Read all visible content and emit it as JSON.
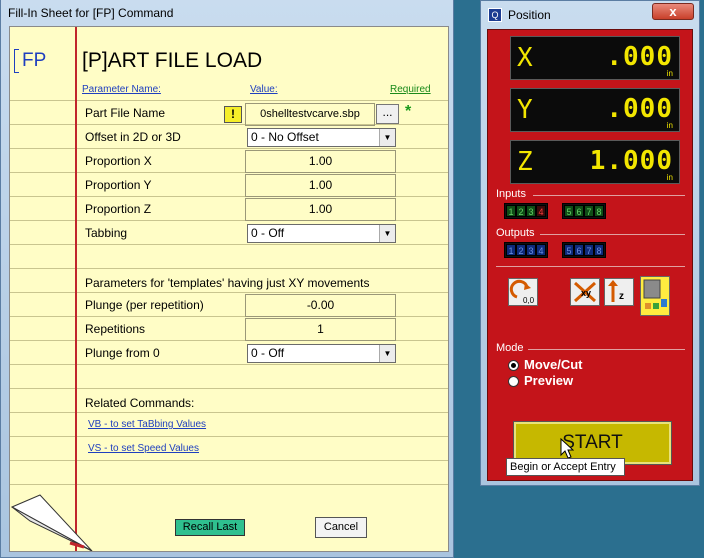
{
  "fillin_window": {
    "title": "Fill-In Sheet for [FP] Command",
    "command_code": "FP",
    "heading": "[P]ART FILE LOAD",
    "col_param": "Parameter Name:",
    "col_value": "Value:",
    "col_required": "Required",
    "params": [
      {
        "label": "Part File Name",
        "value": "0shelltestvcarve.sbp",
        "warn": "!",
        "browse": "...",
        "required_mark": "*"
      },
      {
        "label": "Offset in 2D or 3D",
        "value": "0 - No Offset"
      },
      {
        "label": "Proportion X",
        "value": "1.00"
      },
      {
        "label": "Proportion Y",
        "value": "1.00"
      },
      {
        "label": "Proportion Z",
        "value": "1.00"
      },
      {
        "label": "Tabbing",
        "value": "0 - Off"
      }
    ],
    "templates_note": "Parameters for 'templates' having just XY movements",
    "params2": [
      {
        "label": "Plunge (per repetition)",
        "value": "-0.00"
      },
      {
        "label": "Repetitions",
        "value": "1"
      },
      {
        "label": "Plunge from 0",
        "value": "0 - Off"
      }
    ],
    "related_title": "Related Commands:",
    "related_links": [
      "VB - to set TaBbing Values",
      "VS - to set Speed Values"
    ],
    "recall_label": "Recall Last",
    "cancel_label": "Cancel"
  },
  "position_window": {
    "title": "Position",
    "app_icon": "Q",
    "close_label": "x",
    "axes": [
      {
        "axis": "X",
        "value": ".000",
        "unit": "in"
      },
      {
        "axis": "Y",
        "value": ".000",
        "unit": "in"
      },
      {
        "axis": "Z",
        "value": "1.000",
        "unit": "in"
      }
    ],
    "inputs_label": "Inputs",
    "inputs": [
      "1",
      "2",
      "3",
      "4",
      "5",
      "6",
      "7",
      "8"
    ],
    "input4_active_color": "#ff3b3b",
    "outputs_label": "Outputs",
    "outputs": [
      "1",
      "2",
      "3",
      "4",
      "5",
      "6",
      "7",
      "8"
    ],
    "mode_label": "Mode",
    "mode_options": [
      "Move/Cut",
      "Preview"
    ],
    "mode_selected": "Move/Cut",
    "start_label": "START",
    "tooltip": "Begin or Accept Entry",
    "colors": {
      "panel": "#c4141a",
      "dro_text": "#f2e600",
      "start": "#c6b800"
    }
  }
}
